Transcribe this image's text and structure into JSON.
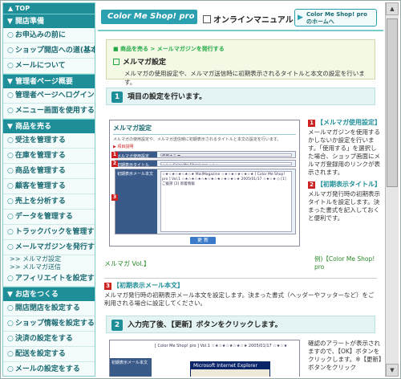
{
  "sidebar": {
    "top": "▲ TOP",
    "sections": [
      {
        "header": "▼ 開店準備",
        "items": [
          "お申込みの前に",
          "ショップ開店への道(基本編)",
          "メールについて"
        ]
      },
      {
        "header": "▼ 管理者ページ概要",
        "items": [
          "管理者ページへログインする",
          "メニュー画面を使用する"
        ]
      },
      {
        "header": "▼ 商品を売る",
        "items": [
          "受注を管理する",
          "在庫を管理する",
          "商品を管理する",
          "顧客を管理する",
          "売上を分析する",
          "データを管理する",
          "トラックバックを管理する",
          "メールマガジンを発行する"
        ],
        "subs": [
          ">> メルマガ設定",
          ">> メルマガ送信"
        ],
        "after": [
          "アフィリエイトを設定する"
        ]
      },
      {
        "header": "▼ お店をつくる",
        "items": [
          "開店閉店を設定する",
          "ショップ情報を設定する",
          "決済の設定をする",
          "配送を設定する",
          "メールの設定をする"
        ]
      }
    ]
  },
  "header": {
    "logo": "Color Me Shop! pro",
    "manual": "オンラインマニュアル",
    "home_button": "Color Me Shop! pro のホームへ"
  },
  "main": {
    "breadcrumb": "■ 商品を売る > メールマガジンを発行する",
    "page_title": "メルマガ設定",
    "page_desc": "メルマガの使用設定や、メルマガ送信時に初期表示されるタイトルと本文の設定を行います。",
    "step1": "項目の設定を行います。",
    "shot": {
      "title": "メルマガ設定",
      "desc": "メルマガの使用設定や、メルマガ送信時に初期表示されるタイトルと本文の設定を行います。",
      "link": "▶ 項目説明",
      "row1_label": "メルマガ使用設定",
      "row1_value": "使用する ▼",
      "row2_label": "初期表示タイトル",
      "row2_value": "☆★☆ Color Me Shop! pro ☆★☆",
      "row3_label": "初期表示メール本文",
      "row3_value": "☆★☆★☆★☆★☆★ MailMagazine ☆★☆★☆★☆★☆★ [ Color Me Shop! pro ] Vol.1 ☆★☆★☆★☆★☆★☆★☆★☆★☆★ 2005/01/17 ☆★☆★ ◇ [1] ご挨拶 [2] 新着情報",
      "update": "更 新"
    },
    "notes": [
      {
        "num": "1",
        "title": "【メルマガ使用設定】",
        "body": "メールマガジンを使用するかしないか設定を行います。「使用する」を選択した場合、ショップ画面にメルマガ登録用のリンクが表示されます。"
      },
      {
        "num": "2",
        "title": "【初期表示タイトル】",
        "body": "メルマガ発行時の初期表示タイトルを設定します。決まった書式を記入しておくと便利です。"
      }
    ],
    "link_example": "例)【Color Me Shop! pro",
    "link_vol": "メルマガ Vol.】",
    "sec3_num": "3",
    "sec3_title": "【初期表示メール本文】",
    "sec3_body": "メルマガ発行時の初期表示メール本文を設定します。決まった書式（ヘッダーやフッターなど）をご利用される場合に設定してください。",
    "step2": "入力完了後、【更新】ボタンをクリックします。",
    "shot2_label": "初期表示メール本文",
    "shot2_text": "[ Color Me Shop! pro ] Vol.1 ☆★☆★☆★☆★☆★ 2005/01/17 ☆★☆★",
    "dialog_title": "Microsoft Internet Explorer",
    "notes2": "確認のアラートが表示されますので、【OK】ボタンをクリックします。※【更新】ボタンをクリック"
  }
}
